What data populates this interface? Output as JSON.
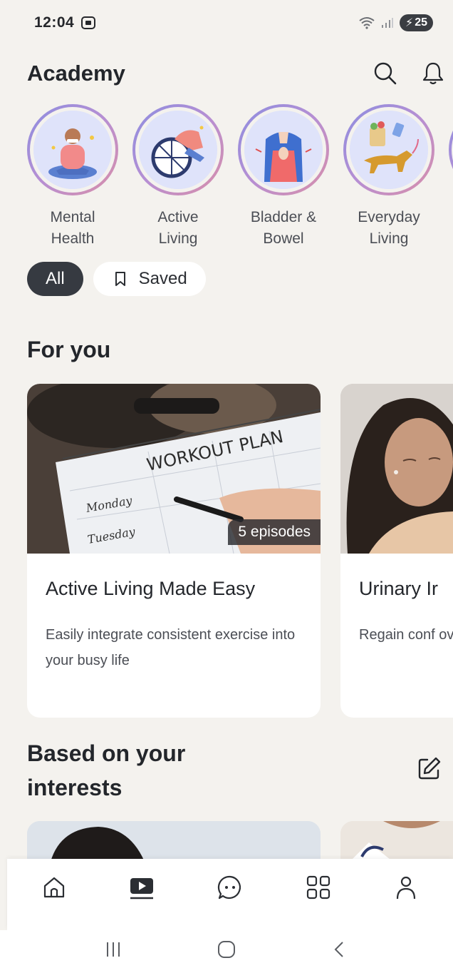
{
  "status_bar": {
    "time": "12:04",
    "battery": "25"
  },
  "header": {
    "title": "Academy",
    "search_icon": "search-icon",
    "bell_icon": "bell-icon"
  },
  "categories": [
    {
      "label": "Mental\nHealth"
    },
    {
      "label": "Active\nLiving"
    },
    {
      "label": "Bladder &\nBowel"
    },
    {
      "label": "Everyday\nLiving"
    }
  ],
  "filters": {
    "all": "All",
    "saved": "Saved"
  },
  "sections": {
    "for_you": "For you",
    "interests": "Based on your interests"
  },
  "cards": [
    {
      "title": "Active Living Made Easy",
      "description": "Easily integrate consistent exercise into your busy life",
      "badge": "5 episodes"
    },
    {
      "title": "Urinary Ir",
      "description": "Regain conf over urinary"
    }
  ],
  "bottom_nav": [
    "home-icon",
    "academy-play-icon",
    "chat-icon",
    "apps-grid-icon",
    "profile-icon"
  ],
  "colors": {
    "background": "#f4f2ee",
    "dark": "#363a41",
    "ring_start": "#8c8ee0",
    "ring_end": "#d98fa8"
  }
}
